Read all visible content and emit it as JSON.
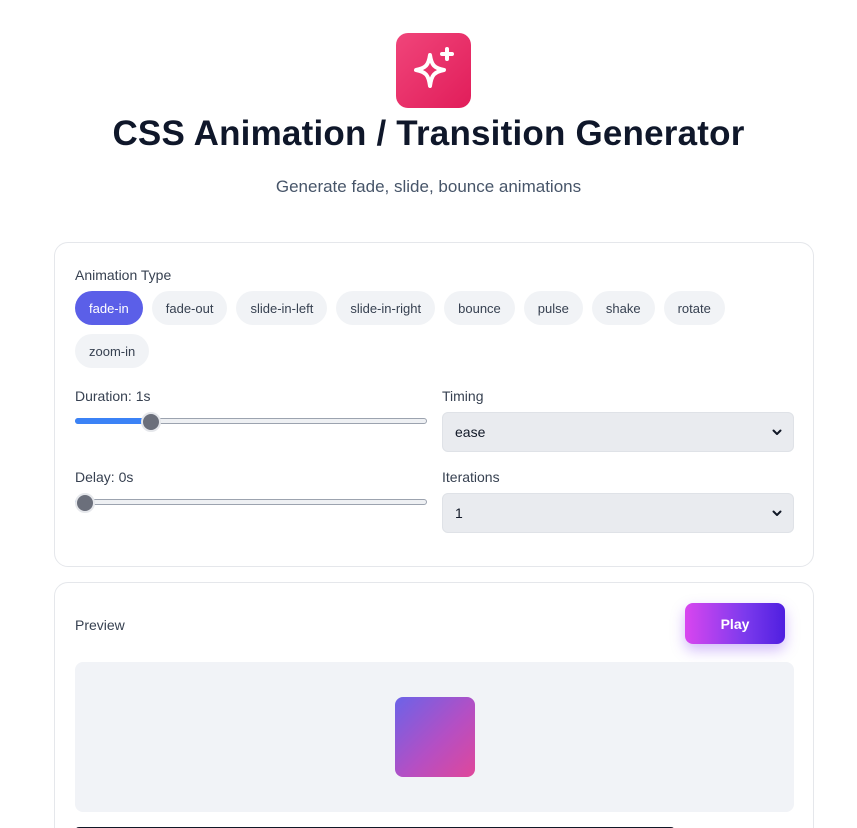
{
  "header": {
    "logo_icon": "sparkles-icon",
    "title": "CSS Animation / Transition Generator",
    "subtitle": "Generate fade, slide, bounce animations"
  },
  "settings": {
    "animation_type_label": "Animation Type",
    "types": [
      {
        "label": "fade-in",
        "active": true
      },
      {
        "label": "fade-out",
        "active": false
      },
      {
        "label": "slide-in-left",
        "active": false
      },
      {
        "label": "slide-in-right",
        "active": false
      },
      {
        "label": "bounce",
        "active": false
      },
      {
        "label": "pulse",
        "active": false
      },
      {
        "label": "shake",
        "active": false
      },
      {
        "label": "rotate",
        "active": false
      },
      {
        "label": "zoom-in",
        "active": false
      }
    ],
    "duration_label": "Duration: 1s",
    "duration_fraction": 0.2,
    "delay_label": "Delay: 0s",
    "delay_fraction": 0.0,
    "timing_label": "Timing",
    "timing_value": "ease",
    "iterations_label": "Iterations",
    "iterations_value": "1"
  },
  "preview": {
    "label": "Preview",
    "play_label": "Play"
  },
  "colors": {
    "accent": "#5b5fe8",
    "logo": "#e11d5a"
  }
}
